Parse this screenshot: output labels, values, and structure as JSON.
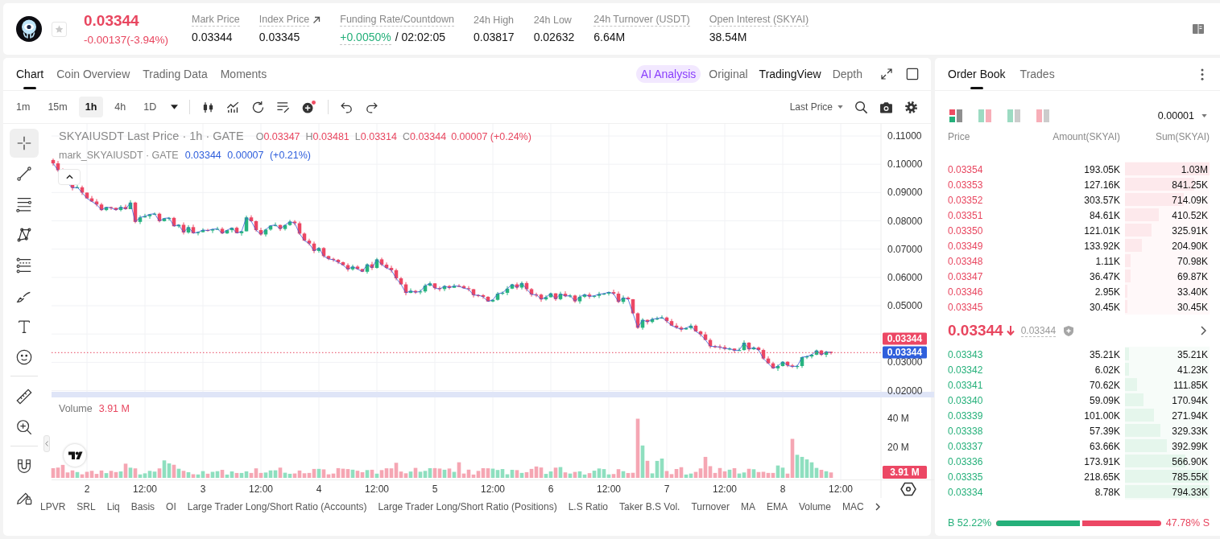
{
  "ticker": {
    "price": "0.03344",
    "change": "-0.00137(-3.94%)",
    "falling": true,
    "favorite": false
  },
  "stats": [
    {
      "kind": "plain",
      "label": "Mark Price",
      "value": "0.03344",
      "tooltip": true
    },
    {
      "kind": "link",
      "label": "Index Price",
      "value": "0.03345",
      "tooltip": true
    },
    {
      "kind": "funding",
      "label": "Funding Rate/Countdown",
      "value": "+0.0050%",
      "countdown": "/ 02:02:05",
      "tooltip": true
    },
    {
      "kind": "plain",
      "label": "24h High",
      "value": "0.03817",
      "tooltip": false
    },
    {
      "kind": "plain",
      "label": "24h Low",
      "value": "0.02632",
      "tooltip": false
    },
    {
      "kind": "plain",
      "label": "24h Turnover (USDT)",
      "value": "6.64M",
      "tooltip": true
    },
    {
      "kind": "plain",
      "label": "Open Interest (SKYAI)",
      "value": "38.54M",
      "tooltip": true
    }
  ],
  "chart_panel": {
    "tabs": [
      {
        "label": "Chart",
        "selected": true
      },
      {
        "label": "Coin Overview",
        "selected": false
      },
      {
        "label": "Trading Data",
        "selected": false
      },
      {
        "label": "Moments",
        "selected": false
      }
    ],
    "views": [
      {
        "kind": "ai",
        "label": "AI Analysis",
        "selected": false
      },
      {
        "kind": "plain",
        "label": "Original",
        "selected": false
      },
      {
        "kind": "plain",
        "label": "TradingView",
        "selected": true
      },
      {
        "kind": "plain",
        "label": "Depth",
        "selected": false
      }
    ],
    "intervals": [
      {
        "label": "1m",
        "selected": false
      },
      {
        "label": "15m",
        "selected": false
      },
      {
        "label": "1h",
        "selected": true
      },
      {
        "label": "4h",
        "selected": false
      },
      {
        "label": "1D",
        "selected": false
      }
    ],
    "price_source": "Last Price",
    "drawing_tools": [
      [
        {
          "kind": "crosshair",
          "selected": true
        },
        {
          "kind": "trendline",
          "selected": false
        },
        {
          "kind": "lines",
          "selected": false
        },
        {
          "kind": "pattern",
          "selected": false
        },
        {
          "kind": "fib",
          "selected": false
        },
        {
          "kind": "brush",
          "selected": false
        },
        {
          "kind": "text",
          "selected": false
        },
        {
          "kind": "emoji",
          "selected": false
        }
      ],
      [
        {
          "kind": "ruler",
          "selected": false
        },
        {
          "kind": "zoom",
          "selected": false
        }
      ],
      [
        {
          "kind": "magnet",
          "selected": false
        },
        {
          "kind": "lock",
          "selected": false
        }
      ]
    ],
    "legend": {
      "title": "SKYAIUSDT Last Price · 1h · GATE",
      "ohlc": [
        {
          "key": "O",
          "value": "0.03347"
        },
        {
          "key": "H",
          "value": "0.03481"
        },
        {
          "key": "L",
          "value": "0.03314"
        },
        {
          "key": "C",
          "value": "0.03344"
        }
      ],
      "change": "0.00007 (+0.24%)",
      "mark_title": "mark_SKYAIUSDT · GATE",
      "mark_change": "0.03344 0.00007 (+0.21%)"
    },
    "price_axis": {
      "upper_labels": [
        "0.11000",
        "0.10000",
        "0.09000",
        "0.08000",
        "0.07000",
        "0.06000",
        "0.05000"
      ],
      "lower_labels": [
        "0.03000",
        "0.02000"
      ],
      "last_price_tag": "0.03344",
      "mark_price_tag": "0.03344"
    },
    "volume": {
      "label": "Volume",
      "value": "3.91 M",
      "axis_labels": [
        "40 M",
        "20 M"
      ],
      "tag": "3.91 M"
    },
    "time_axis": [
      "2",
      "12:00",
      "3",
      "12:00",
      "4",
      "12:00",
      "5",
      "12:00",
      "6",
      "12:00",
      "7",
      "12:00",
      "8",
      "12:00"
    ],
    "indicators": [
      "LPVR",
      "SRL",
      "Liq",
      "Basis",
      "OI",
      "Large Trader Long/Short Ratio (Accounts)",
      "Large Trader Long/Short Ratio (Positions)",
      "L.S Ratio",
      "Taker B.S Vol.",
      "Turnover",
      "MA",
      "EMA",
      "Volume",
      "MAC"
    ]
  },
  "order_book": {
    "tabs": [
      {
        "label": "Order Book",
        "selected": true
      },
      {
        "label": "Trades",
        "selected": false
      }
    ],
    "layouts": [
      {
        "kind": "both",
        "selected": true
      },
      {
        "kind": "split",
        "selected": false
      },
      {
        "kind": "bids",
        "selected": false
      },
      {
        "kind": "asks",
        "selected": false
      }
    ],
    "precision": "0.00001",
    "columns": [
      "Price",
      "Amount(SKYAI)",
      "Sum(SKYAI)"
    ],
    "asks": [
      {
        "price": "0.03354",
        "amount": "193.05K",
        "sum": "1.03M",
        "level": 1.0
      },
      {
        "price": "0.03353",
        "amount": "127.16K",
        "sum": "841.25K",
        "level": 0.817
      },
      {
        "price": "0.03352",
        "amount": "303.57K",
        "sum": "714.09K",
        "level": 0.693
      },
      {
        "price": "0.03351",
        "amount": "84.61K",
        "sum": "410.52K",
        "level": 0.399
      },
      {
        "price": "0.03350",
        "amount": "121.01K",
        "sum": "325.91K",
        "level": 0.316
      },
      {
        "price": "0.03349",
        "amount": "133.92K",
        "sum": "204.90K",
        "level": 0.199
      },
      {
        "price": "0.03348",
        "amount": "1.11K",
        "sum": "70.98K",
        "level": 0.069
      },
      {
        "price": "0.03347",
        "amount": "36.47K",
        "sum": "69.87K",
        "level": 0.068
      },
      {
        "price": "0.03346",
        "amount": "2.95K",
        "sum": "33.40K",
        "level": 0.032
      },
      {
        "price": "0.03345",
        "amount": "30.45K",
        "sum": "30.45K",
        "level": 0.03
      }
    ],
    "mid": {
      "price": "0.03344",
      "falling": true,
      "mark": "0.03344"
    },
    "bids": [
      {
        "price": "0.03343",
        "amount": "35.21K",
        "sum": "35.21K",
        "level": 0.044
      },
      {
        "price": "0.03342",
        "amount": "6.02K",
        "sum": "41.23K",
        "level": 0.052
      },
      {
        "price": "0.03341",
        "amount": "70.62K",
        "sum": "111.85K",
        "level": 0.141
      },
      {
        "price": "0.03340",
        "amount": "59.09K",
        "sum": "170.94K",
        "level": 0.215
      },
      {
        "price": "0.03339",
        "amount": "101.00K",
        "sum": "271.94K",
        "level": 0.342
      },
      {
        "price": "0.03338",
        "amount": "57.39K",
        "sum": "329.33K",
        "level": 0.415
      },
      {
        "price": "0.03337",
        "amount": "63.66K",
        "sum": "392.99K",
        "level": 0.495
      },
      {
        "price": "0.03336",
        "amount": "173.91K",
        "sum": "566.90K",
        "level": 0.714
      },
      {
        "price": "0.03335",
        "amount": "218.65K",
        "sum": "785.55K",
        "level": 0.989
      },
      {
        "price": "0.03334",
        "amount": "8.78K",
        "sum": "794.33K",
        "level": 1.0
      }
    ],
    "ratio": {
      "buy": "B 52.22%",
      "sell": "47.78% S",
      "level": 0.5222
    }
  }
}
